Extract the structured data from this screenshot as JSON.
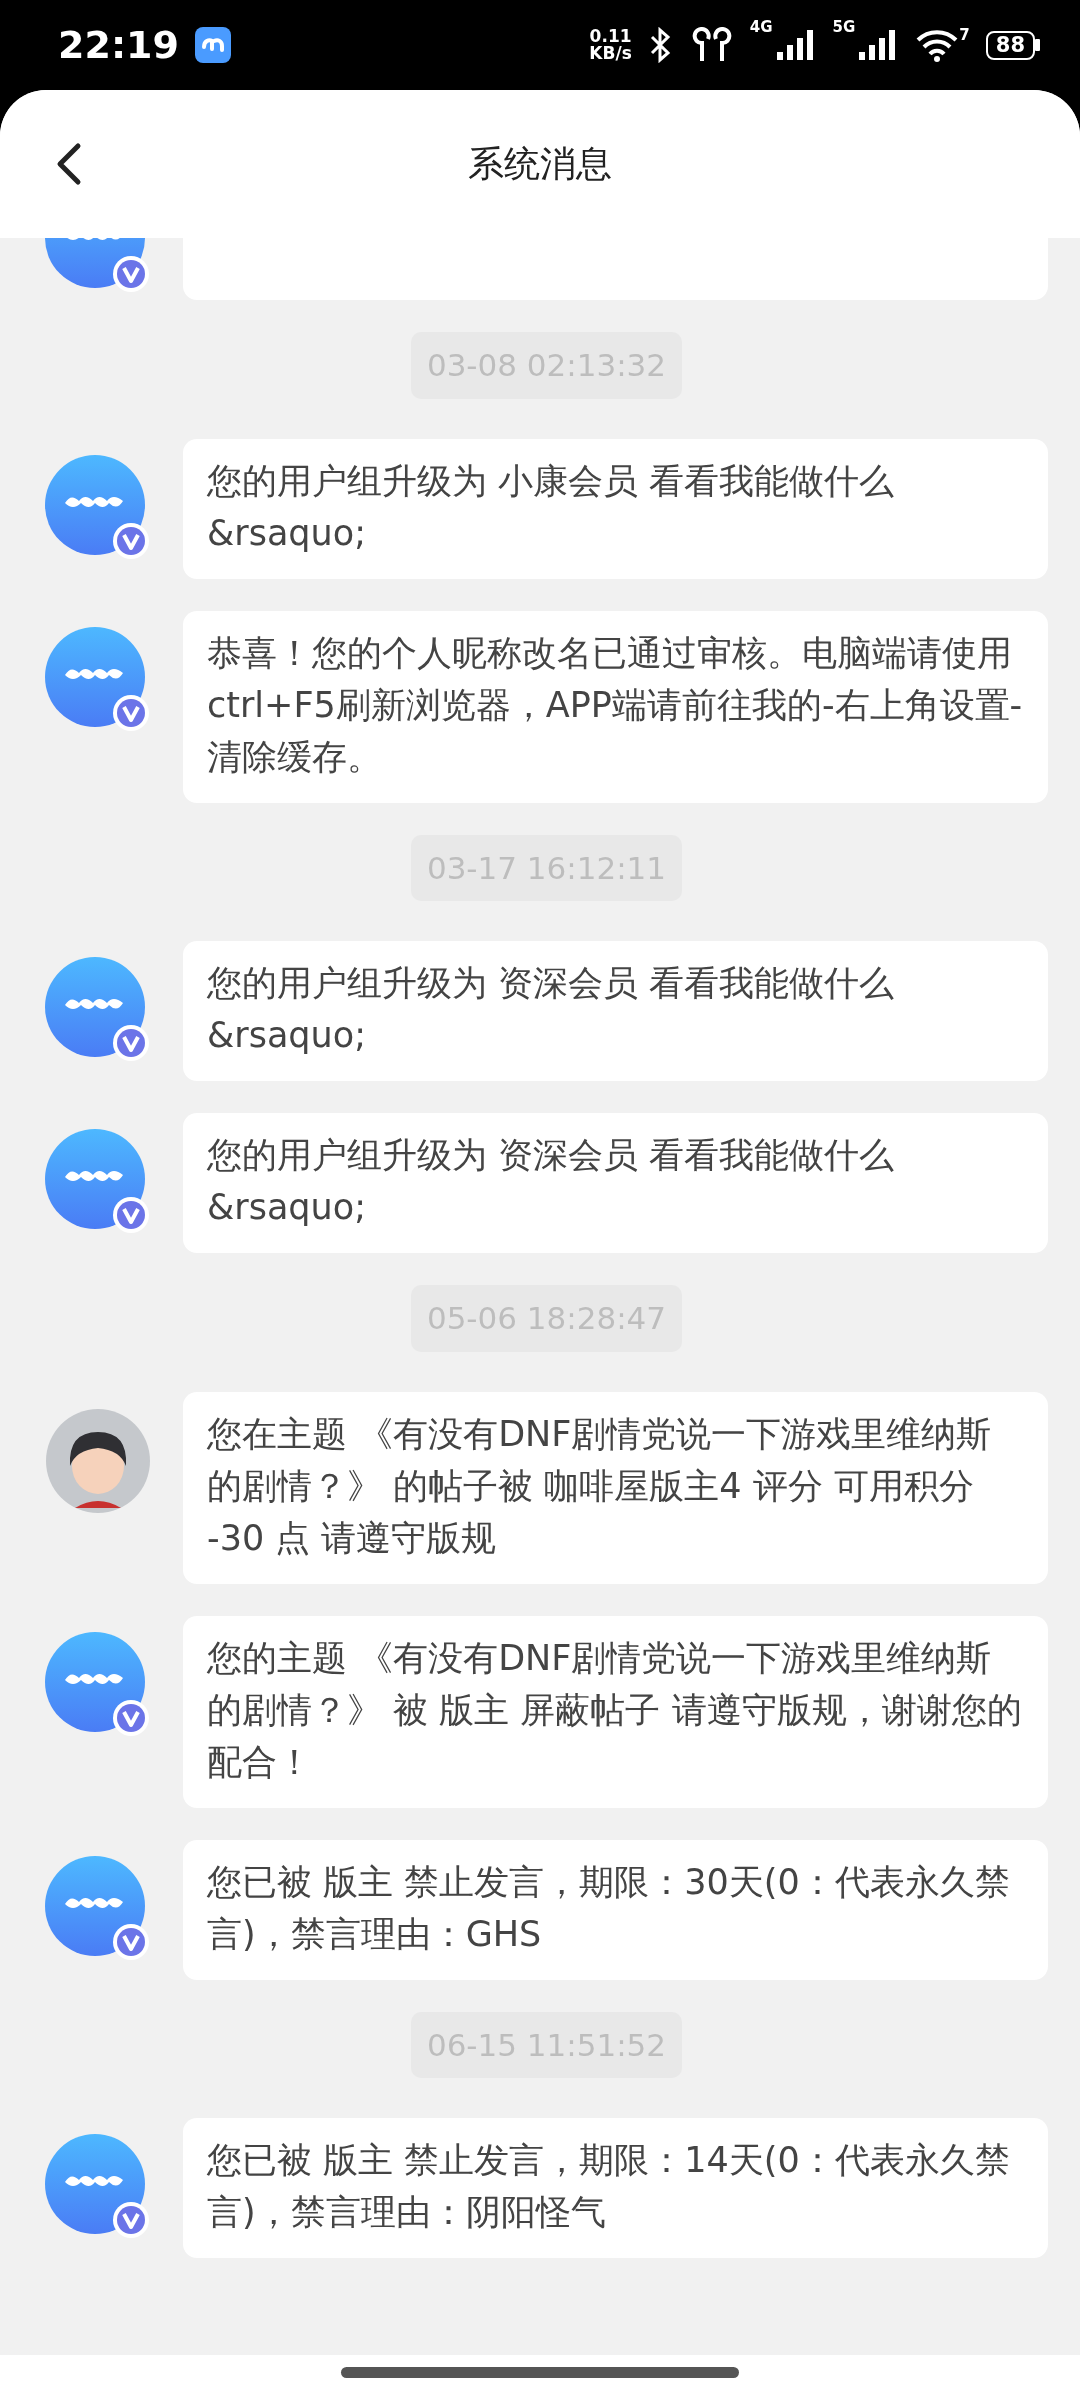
{
  "status_bar": {
    "time": "22:19",
    "speed_value": "0.11",
    "speed_unit": "KB/s",
    "network_1": "4G",
    "network_2": "5G",
    "wifi_badge": "7",
    "battery": "88"
  },
  "header": {
    "title": "系统消息"
  },
  "items": [
    {
      "kind": "cut_message",
      "avatar": {
        "kind": "colg"
      }
    },
    {
      "kind": "time",
      "text": "03-08 02:13:32"
    },
    {
      "kind": "message",
      "avatar": {
        "kind": "colg"
      },
      "text": "您的用户组升级为 小康会员  看看我能做什么 &rsaquo;"
    },
    {
      "kind": "message",
      "avatar": {
        "kind": "colg"
      },
      "text": "恭喜！您的个人昵称改名已通过审核。电脑端请使用ctrl+F5刷新浏览器，APP端请前往我的-右上角设置-清除缓存。"
    },
    {
      "kind": "time",
      "text": "03-17 16:12:11"
    },
    {
      "kind": "message",
      "avatar": {
        "kind": "colg"
      },
      "text": "您的用户组升级为 资深会员  看看我能做什么 &rsaquo;"
    },
    {
      "kind": "message",
      "avatar": {
        "kind": "colg"
      },
      "text": "您的用户组升级为 资深会员  看看我能做什么 &rsaquo;"
    },
    {
      "kind": "time",
      "text": "05-06 18:28:47"
    },
    {
      "kind": "message",
      "avatar": {
        "kind": "person"
      },
      "text": "您在主题 《有没有DNF剧情党说一下游戏里维纳斯的剧情？》 的帖子被 咖啡屋版主4 评分 可用积分 -30 点 请遵守版规"
    },
    {
      "kind": "message",
      "avatar": {
        "kind": "colg"
      },
      "text": "您的主题 《有没有DNF剧情党说一下游戏里维纳斯的剧情？》 被 版主 屏蔽帖子 请遵守版规，谢谢您的配合！"
    },
    {
      "kind": "message",
      "avatar": {
        "kind": "colg"
      },
      "text": "您已被 版主 禁止发言，期限：30天(0：代表永久禁言)，禁言理由：GHS"
    },
    {
      "kind": "time",
      "text": "06-15 11:51:52"
    },
    {
      "kind": "message",
      "avatar": {
        "kind": "colg"
      },
      "text": "您已被 版主 禁止发言，期限：14天(0：代表永久禁言)，禁言理由：阴阳怪气"
    }
  ]
}
